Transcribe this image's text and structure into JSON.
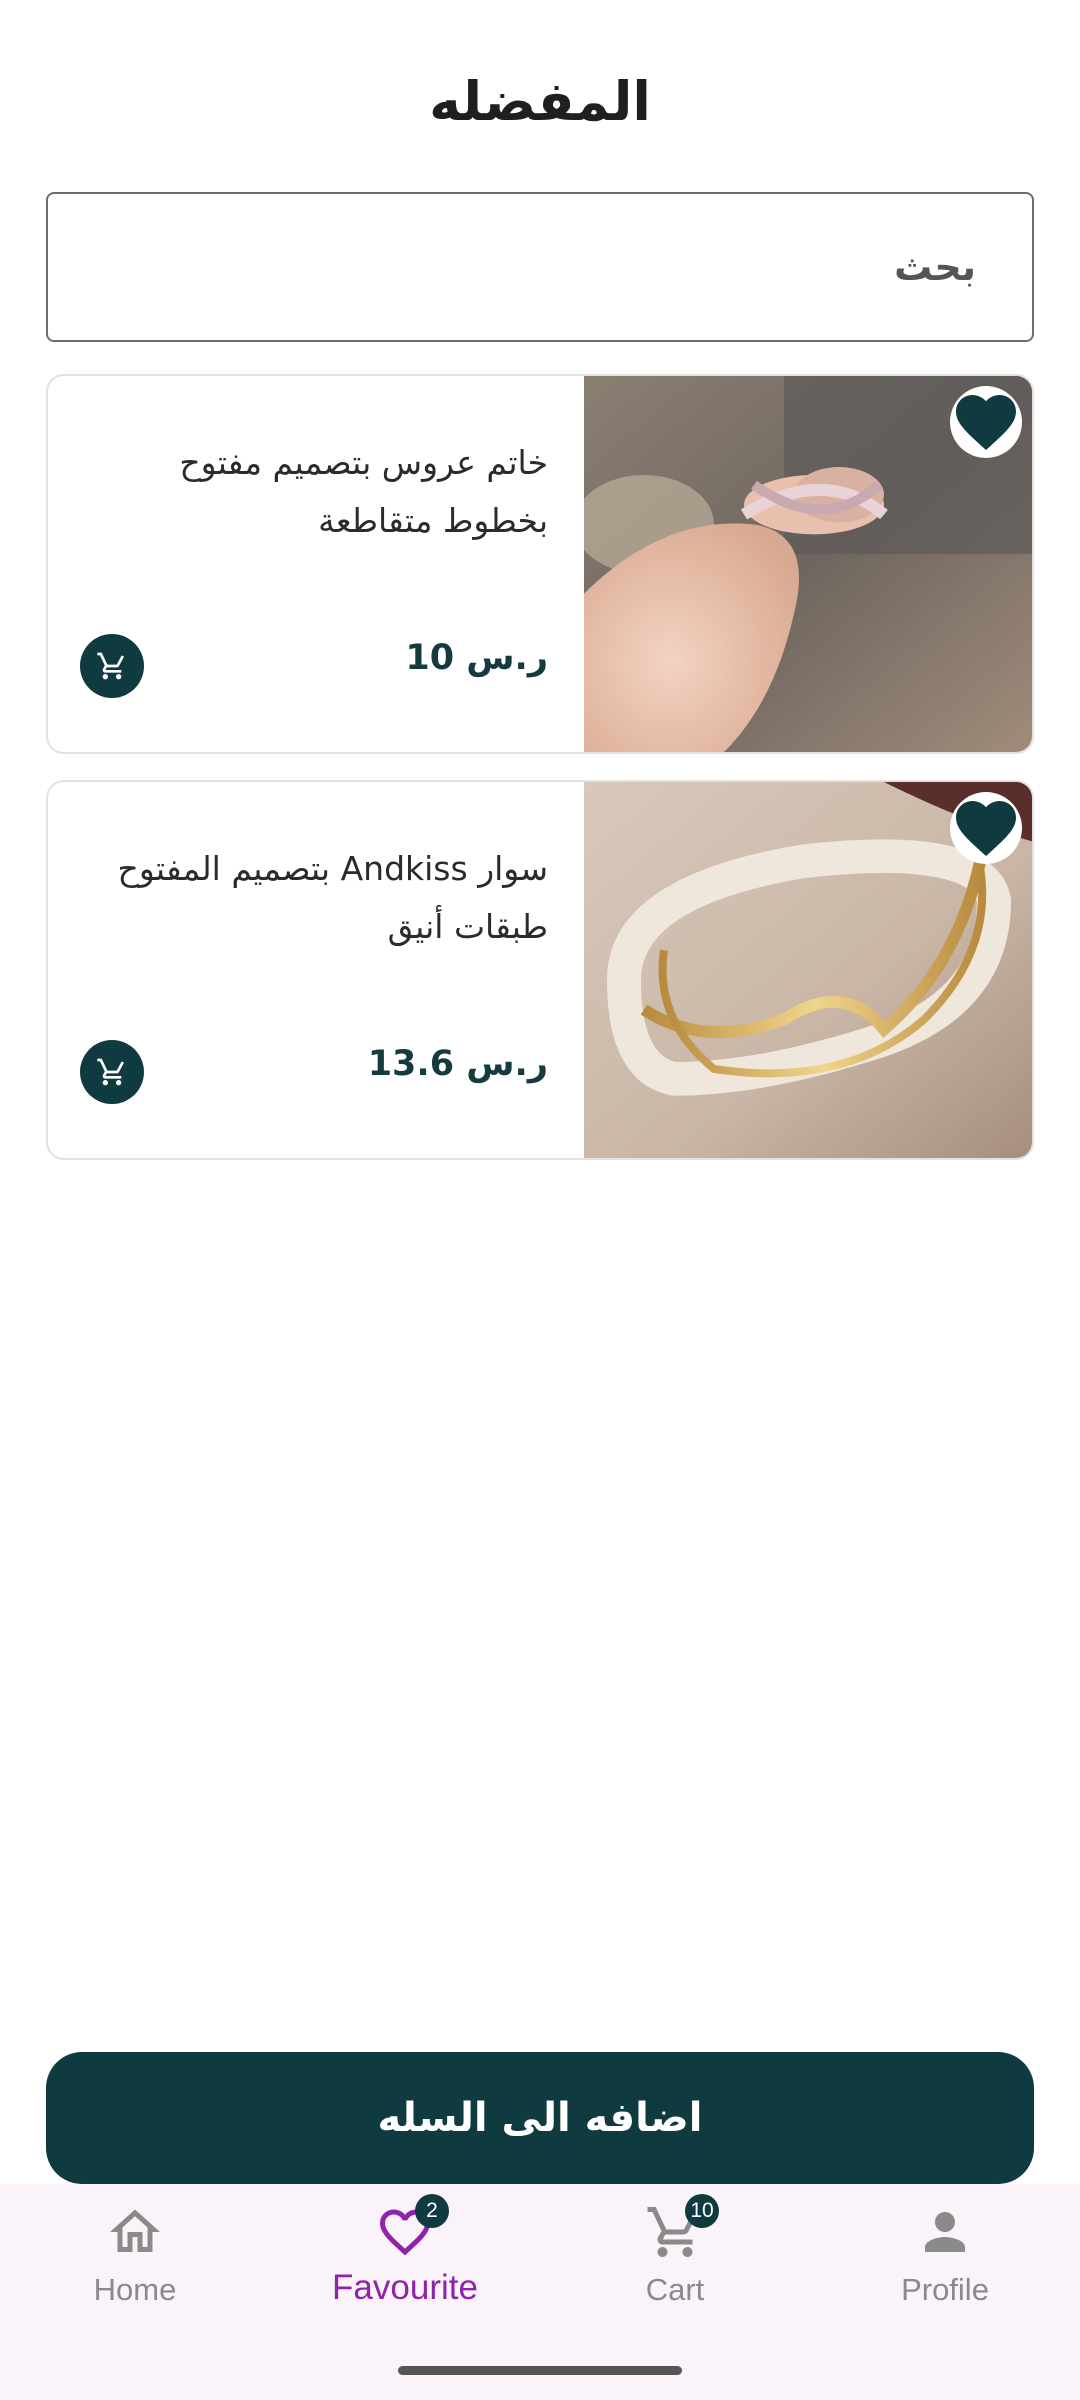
{
  "header": {
    "title": "المفضله"
  },
  "search": {
    "placeholder": "بحث"
  },
  "products": [
    {
      "title": "خاتم عروس بتصميم مفتوح بخطوط متقاطعة",
      "price": "10 ر.س",
      "image": "ring-photo",
      "favorite": true
    },
    {
      "title": "سوار Andkiss بتصميم المفتوح طبقات أنيق",
      "price": "13.6 ر.س",
      "image": "bracelet-photo",
      "favorite": true
    }
  ],
  "actions": {
    "add_to_cart_label": "اضافه الى السله"
  },
  "nav": {
    "items": [
      {
        "label": "Home",
        "icon": "home-icon",
        "active": false
      },
      {
        "label": "Favourite",
        "icon": "heart-icon",
        "active": true,
        "badge": "2"
      },
      {
        "label": "Cart",
        "icon": "cart-icon",
        "active": false,
        "badge": "10"
      },
      {
        "label": "Profile",
        "icon": "person-icon",
        "active": false
      }
    ]
  },
  "colors": {
    "primary": "#0f3a40",
    "accent": "#8e24aa",
    "nav_bg": "#fbf3fa"
  }
}
